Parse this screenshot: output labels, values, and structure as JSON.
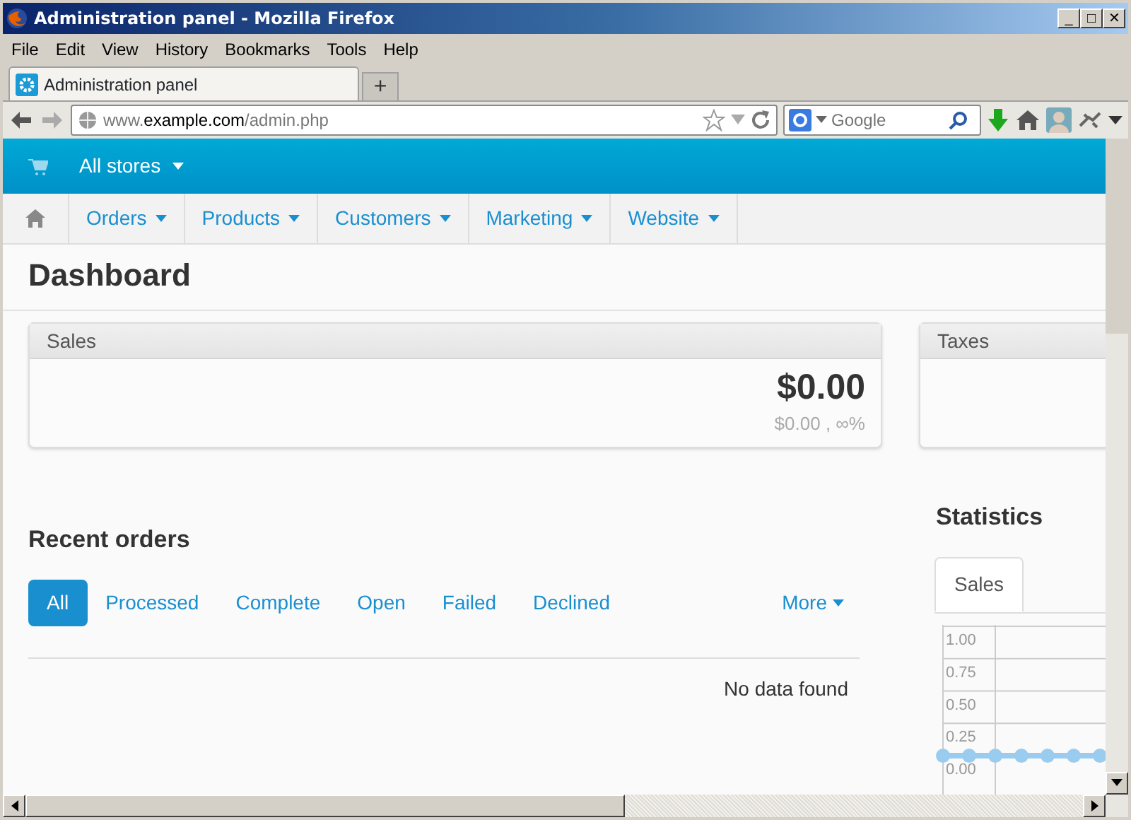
{
  "window": {
    "title": "Administration panel - Mozilla Firefox",
    "controls": [
      "_",
      "□",
      "✕"
    ]
  },
  "menu": [
    "File",
    "Edit",
    "View",
    "History",
    "Bookmarks",
    "Tools",
    "Help"
  ],
  "browser_tabs": [
    {
      "label": "Administration panel",
      "selected": true
    }
  ],
  "new_tab": "+",
  "address": {
    "prefix": "www.",
    "domain": "example.com",
    "path": "/admin.php"
  },
  "search": {
    "placeholder": "Google"
  },
  "store_menu": "All stores",
  "nav": [
    "Orders",
    "Products",
    "Customers",
    "Marketing",
    "Website"
  ],
  "page_title": "Dashboard",
  "cards": [
    {
      "title": "Sales",
      "value": "$0.00",
      "sub": "$0.00 , ∞%"
    },
    {
      "title": "Taxes"
    }
  ],
  "recent_orders": {
    "title": "Recent orders",
    "filters": [
      {
        "label": "All",
        "selected": true
      },
      {
        "label": "Processed",
        "selected": false
      },
      {
        "label": "Complete",
        "selected": false
      },
      {
        "label": "Open",
        "selected": false
      },
      {
        "label": "Failed",
        "selected": false
      },
      {
        "label": "Declined",
        "selected": false
      }
    ],
    "more": "More",
    "empty": "No data found"
  },
  "statistics": {
    "title": "Statistics",
    "tabs": [
      {
        "label": "Sales",
        "selected": true
      }
    ],
    "chart_data": {
      "type": "line",
      "ylim": [
        -0.3,
        1
      ],
      "grid": true,
      "yticks": [
        {
          "value": 1,
          "label": "1.00"
        },
        {
          "value": 0.75,
          "label": "0.75"
        },
        {
          "value": 0.5,
          "label": "0.50"
        },
        {
          "value": 0.25,
          "label": "0.25"
        },
        {
          "value": 0,
          "label": "0.00"
        }
      ],
      "series": [
        {
          "color": "#99ccee",
          "marker": true,
          "values": [
            0,
            0,
            0,
            0,
            0,
            0,
            0
          ]
        }
      ]
    }
  }
}
